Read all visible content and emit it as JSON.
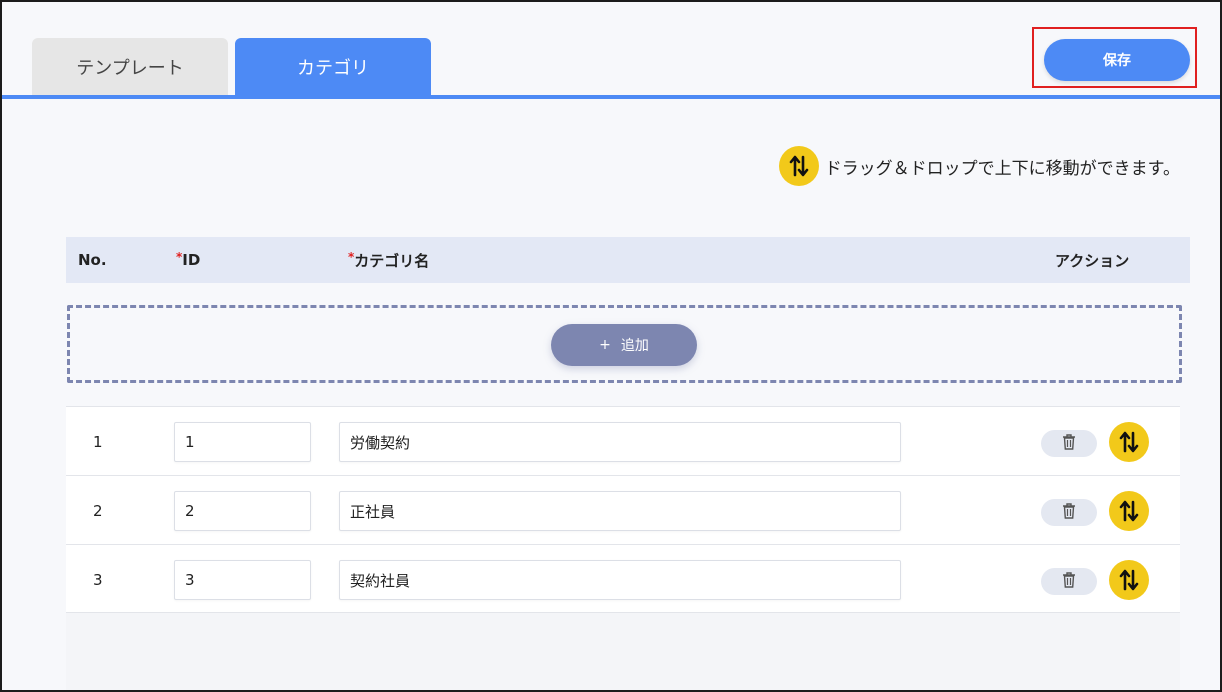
{
  "tabs": {
    "template": "テンプレート",
    "category": "カテゴリ"
  },
  "toolbar": {
    "save_label": "保存"
  },
  "hint": {
    "icon": "up-down-arrows-icon",
    "text": "ドラッグ＆ドロップで上下に移動ができます。"
  },
  "table": {
    "headers": {
      "no": "No.",
      "id_required_mark": "*",
      "id": "ID",
      "name_required_mark": "*",
      "name": "カテゴリ名",
      "action": "アクション"
    },
    "add_label": "追加",
    "add_icon": "+",
    "rows": [
      {
        "no": "1",
        "id": "1",
        "name": "労働契約"
      },
      {
        "no": "2",
        "id": "2",
        "name": "正社員"
      },
      {
        "no": "3",
        "id": "3",
        "name": "契約社員"
      }
    ]
  },
  "colors": {
    "accent": "#4d8af5",
    "move_icon": "#f2c91a",
    "add_button": "#7d86b0",
    "highlight_border": "#e02020"
  }
}
